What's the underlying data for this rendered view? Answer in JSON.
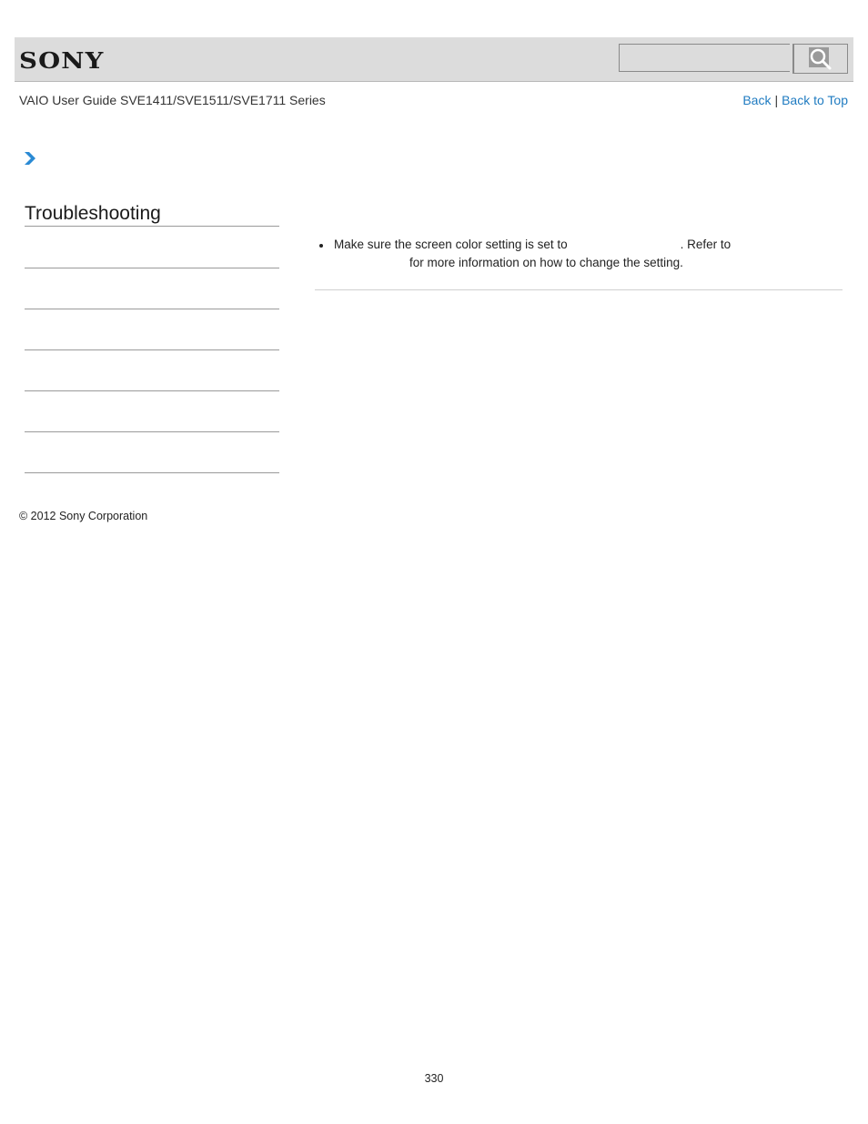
{
  "header": {
    "logo": "SONY",
    "search": {
      "value": "",
      "placeholder": ""
    },
    "search_icon": "magnifier-icon"
  },
  "guide": {
    "title": "VAIO User Guide SVE1411/SVE1511/SVE1711 Series",
    "nav": {
      "back": "Back",
      "separator": "|",
      "back_to_top": "Back to Top"
    }
  },
  "breadcrumb": {
    "icon": "chevron-right-icon"
  },
  "sidebar": {
    "title": "Troubleshooting",
    "items": [
      {
        "label": ""
      },
      {
        "label": ""
      },
      {
        "label": ""
      },
      {
        "label": ""
      },
      {
        "label": ""
      },
      {
        "label": ""
      }
    ]
  },
  "content": {
    "bullets": [
      {
        "part1": "Make sure the screen color setting is set to",
        "part2": ". Refer to",
        "part3": "for more information on how to change the setting."
      }
    ]
  },
  "footer": {
    "copyright": "© 2012 Sony Corporation",
    "page_number": "330"
  },
  "colors": {
    "header_bg": "#dcdcdc",
    "link": "#1f7bc1",
    "chevron": "#2a8ad4"
  }
}
